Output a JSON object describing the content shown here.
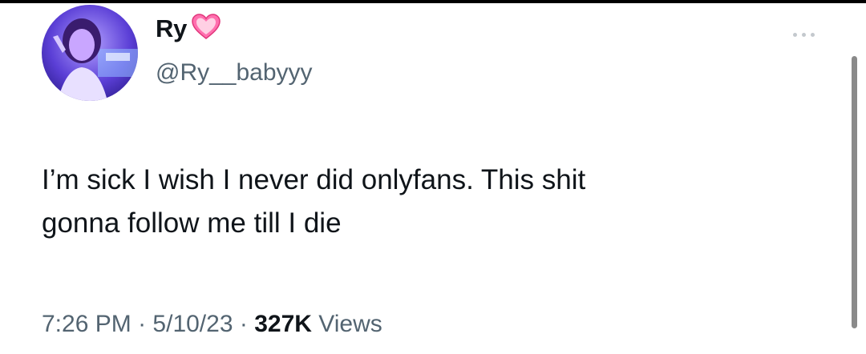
{
  "tweet": {
    "display_name": "Ry",
    "name_emoji": "pink-heart-icon",
    "handle": "@Ry__babyyy",
    "text_line_1": "I’m sick I wish I never did onlyfans. This shit",
    "text_line_2": "gonna follow me till I die",
    "time": "7:26 PM",
    "date": "5/10/23",
    "separator": "·",
    "views_count": "327K",
    "views_label": "Views"
  },
  "colors": {
    "text_primary": "#0f1419",
    "text_secondary": "#536471",
    "heart": "#ff5fa2"
  }
}
